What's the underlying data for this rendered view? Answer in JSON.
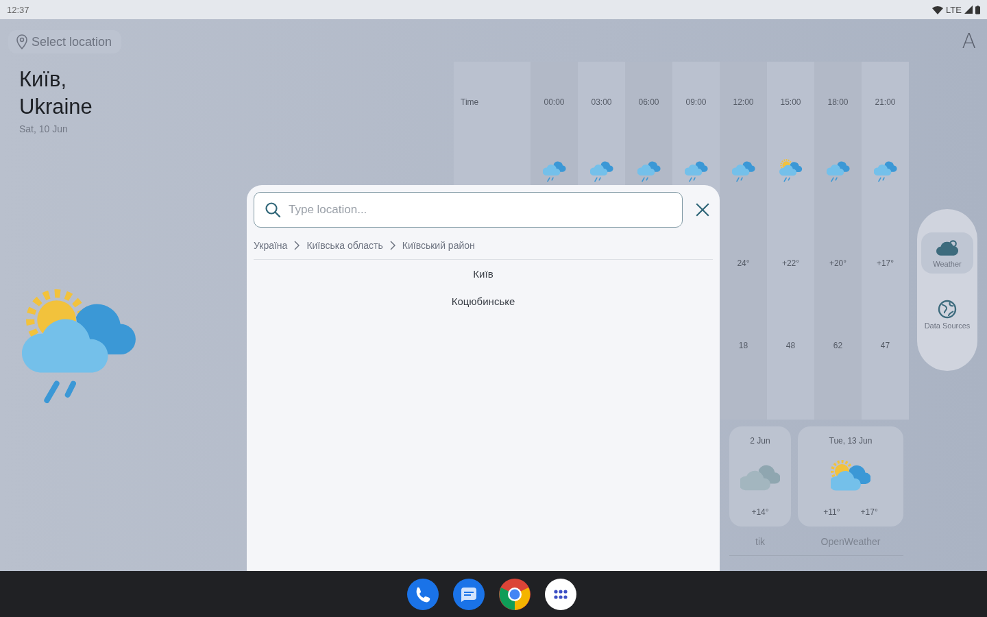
{
  "status_bar": {
    "time": "12:37",
    "network": "LTE"
  },
  "location_button": {
    "label": "Select location"
  },
  "font_button": {
    "label": "A"
  },
  "location": {
    "city": "Київ, Ukraine",
    "date": "Sat, 10 Jun",
    "kind": "sun-rain"
  },
  "forecast_table": {
    "row_label": "Time",
    "columns": [
      {
        "time": "00:00",
        "kind": "rain"
      },
      {
        "time": "03:00",
        "kind": "rain"
      },
      {
        "time": "06:00",
        "kind": "rain"
      },
      {
        "time": "09:00",
        "kind": "rain"
      },
      {
        "time": "12:00",
        "kind": "rain",
        "temperature": "24°",
        "humidity": "18"
      },
      {
        "time": "15:00",
        "kind": "sun-rain",
        "temperature": "+22°",
        "humidity": "48"
      },
      {
        "time": "18:00",
        "kind": "rain",
        "temperature": "+20°",
        "humidity": "62"
      },
      {
        "time": "21:00",
        "kind": "rain",
        "temperature": "+17°",
        "humidity": "47"
      }
    ]
  },
  "daily_cards": [
    {
      "date": "2 Jun",
      "kind": "cloud",
      "high": "+14°"
    },
    {
      "date": "Tue, 13 Jun",
      "kind": "sun-cloud",
      "low": "+11°",
      "high": "+17°"
    }
  ],
  "sources": [
    "tik",
    "OpenWeather"
  ],
  "nav_rail": [
    {
      "label": "Weather",
      "kind": "cloud",
      "selected": true
    },
    {
      "label": "Data Sources",
      "kind": "globe",
      "selected": false
    }
  ],
  "dialog": {
    "search": {
      "placeholder": "Type location..."
    },
    "breadcrumbs": [
      "Україна",
      "Київська область",
      "Київський район"
    ],
    "results": [
      "Київ",
      "Коцюбинське"
    ]
  },
  "taskbar": [
    {
      "kind": "phone"
    },
    {
      "kind": "messages"
    },
    {
      "kind": "browser"
    },
    {
      "kind": "apps"
    }
  ]
}
